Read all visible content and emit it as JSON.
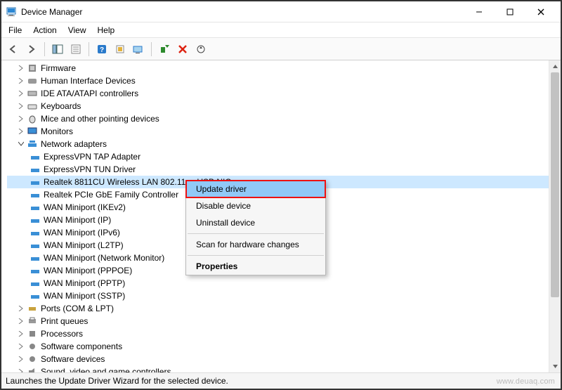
{
  "title": "Device Manager",
  "menu": {
    "file": "File",
    "action": "Action",
    "view": "View",
    "help": "Help"
  },
  "toolbar": {
    "back": "Back",
    "forward": "Forward",
    "showhide": "Show/Hide Console Tree",
    "properties": "Properties",
    "help": "Help",
    "actioncenter": "",
    "devices": "",
    "drivers": "",
    "uninstall": "Uninstall",
    "scan": "Scan for hardware changes"
  },
  "tree": {
    "firmware": "Firmware",
    "hid": "Human Interface Devices",
    "ide": "IDE ATA/ATAPI controllers",
    "keyboards": "Keyboards",
    "mice": "Mice and other pointing devices",
    "monitors": "Monitors",
    "netadapters": "Network adapters",
    "net": {
      "tap": "ExpressVPN TAP Adapter",
      "tun": "ExpressVPN TUN Driver",
      "realtekwlan": "Realtek 8811CU Wireless LAN 802.11ac USB NIC",
      "realtekgbe": "Realtek PCIe GbE Family Controller",
      "wanikev2": "WAN Miniport (IKEv2)",
      "wanip": "WAN Miniport (IP)",
      "wanipv6": "WAN Miniport (IPv6)",
      "wanl2tp": "WAN Miniport (L2TP)",
      "wannm": "WAN Miniport (Network Monitor)",
      "wanpppoe": "WAN Miniport (PPPOE)",
      "wanpptp": "WAN Miniport (PPTP)",
      "wansstp": "WAN Miniport (SSTP)"
    },
    "ports": "Ports (COM & LPT)",
    "printq": "Print queues",
    "processors": "Processors",
    "swcomp": "Software components",
    "swdev": "Software devices",
    "sound": "Sound, video and game controllers"
  },
  "ctx": {
    "update": "Update driver",
    "disable": "Disable device",
    "uninstall": "Uninstall device",
    "scan": "Scan for hardware changes",
    "props": "Properties"
  },
  "status": "Launches the Update Driver Wizard for the selected device.",
  "watermark": "www.deuaq.com"
}
